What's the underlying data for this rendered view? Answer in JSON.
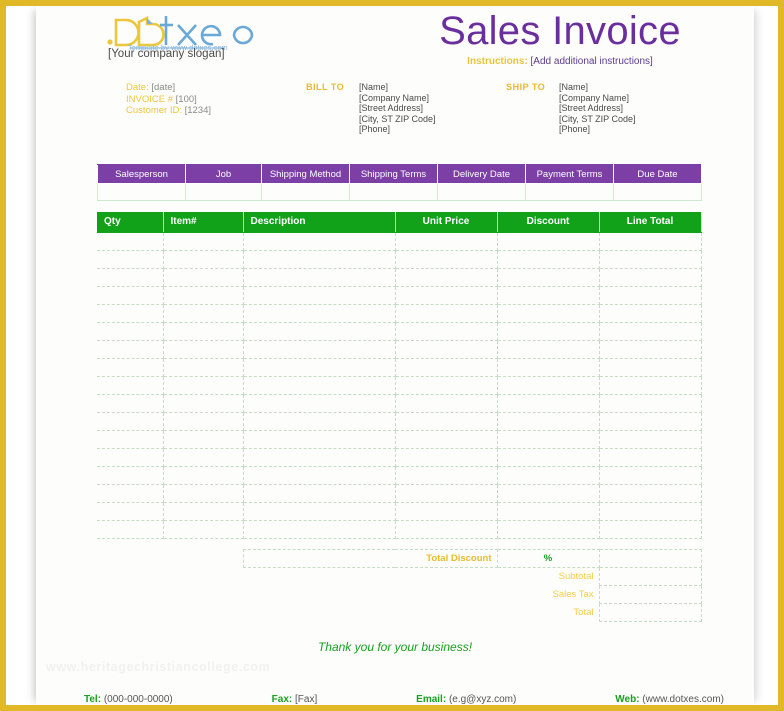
{
  "document": {
    "title": "Sales Invoice",
    "instructions_label": "Instructions",
    "instructions_value": "[Add additional instructions]",
    "watermark": "www.heritagechristiancollege.com"
  },
  "logo": {
    "name": "Dotxes",
    "part_d": "D",
    "part_rest": "txes",
    "tagline": "Template by www.dotxes.com",
    "slogan": "[Your company slogan]"
  },
  "meta": [
    {
      "label": "Date:",
      "value": "[date]"
    },
    {
      "label": "INVOICE #",
      "value": "[100]"
    },
    {
      "label": "Customer ID:",
      "value": "[1234]"
    }
  ],
  "bill_to": {
    "title": "BILL TO",
    "lines": [
      "[Name]",
      "[Company Name]",
      "[Street Address]",
      "[City, ST  ZIP Code]",
      "[Phone]"
    ]
  },
  "ship_to": {
    "title": "SHIP TO",
    "lines": [
      "[Name]",
      "[Company Name]",
      "[Street Address]",
      "[City, ST  ZIP Code]",
      "[Phone]"
    ]
  },
  "info_table": {
    "headers": [
      "Salesperson",
      "Job",
      "Shipping Method",
      "Shipping Terms",
      "Delivery Date",
      "Payment Terms",
      "Due Date"
    ],
    "values": [
      "",
      "",
      "",
      "",
      "",
      "",
      ""
    ]
  },
  "items_table": {
    "headers": [
      "Qty",
      "Item#",
      "Description",
      "Unit Price",
      "Discount",
      "Line Total"
    ],
    "row_count": 17,
    "rows": []
  },
  "totals": {
    "total_discount_label": "Total Discount",
    "percent_symbol": "%",
    "total_discount_value": "",
    "lines": [
      {
        "label": "Subtotal",
        "value": ""
      },
      {
        "label": "Sales Tax",
        "value": ""
      },
      {
        "label": "Total",
        "value": ""
      }
    ]
  },
  "footer": {
    "thanks": "Thank you for your business!",
    "contacts": [
      {
        "label": "Tel:",
        "value": "(000-000-0000)"
      },
      {
        "label": "Fax:",
        "value": "[Fax]"
      },
      {
        "label": "Email:",
        "value": "(e.g@xyz.com)"
      },
      {
        "label": "Web:",
        "value": "(www.dotxes.com)"
      }
    ]
  },
  "colors": {
    "border_gold": "#e0b828",
    "title_purple": "#6a2f9c",
    "header_purple": "#7b3fa5",
    "header_green": "#12a21a",
    "label_gold": "#e8bb2e",
    "grid_green": "#c6dcc6"
  }
}
